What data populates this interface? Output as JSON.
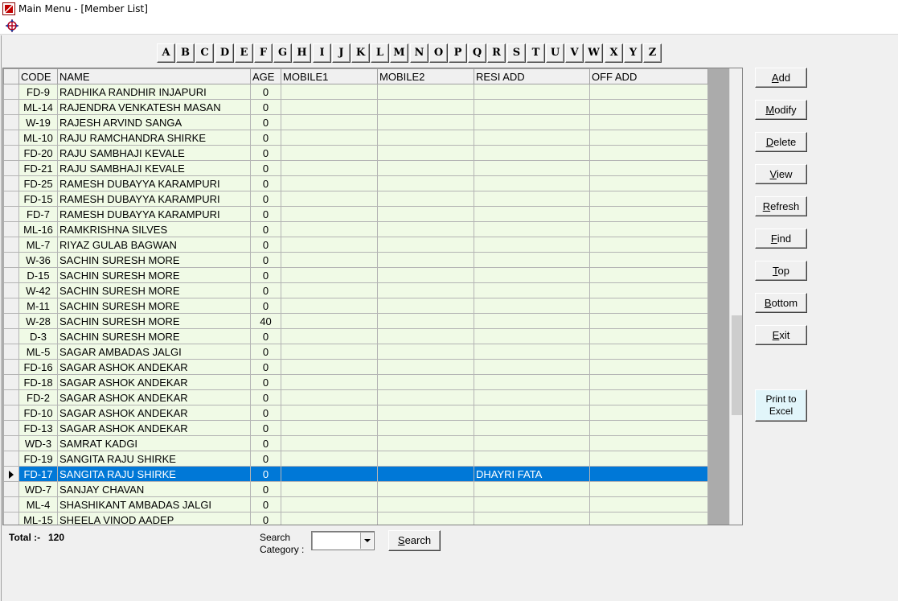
{
  "window": {
    "title": "Main Menu - [Member List]"
  },
  "alphabet": [
    "A",
    "B",
    "C",
    "D",
    "E",
    "F",
    "G",
    "H",
    "I",
    "J",
    "K",
    "L",
    "M",
    "N",
    "O",
    "P",
    "Q",
    "R",
    "S",
    "T",
    "U",
    "V",
    "W",
    "X",
    "Y",
    "Z"
  ],
  "grid": {
    "columns": [
      "CODE",
      "NAME",
      "AGE",
      "MOBILE1",
      "MOBILE2",
      "RESI ADD",
      "OFF ADD"
    ],
    "selected_index": 25,
    "rows": [
      {
        "code": "FD-9",
        "name": "RADHIKA RANDHIR INJAPURI",
        "age": "0",
        "mobile1": "",
        "mobile2": "",
        "resi": "",
        "off": ""
      },
      {
        "code": "ML-14",
        "name": "RAJENDRA VENKATESH MASAN",
        "age": "0",
        "mobile1": "",
        "mobile2": "",
        "resi": "",
        "off": ""
      },
      {
        "code": "W-19",
        "name": "RAJESH ARVIND SANGA",
        "age": "0",
        "mobile1": "",
        "mobile2": "",
        "resi": "",
        "off": ""
      },
      {
        "code": "ML-10",
        "name": "RAJU RAMCHANDRA SHIRKE",
        "age": "0",
        "mobile1": "",
        "mobile2": "",
        "resi": "",
        "off": ""
      },
      {
        "code": "FD-20",
        "name": "RAJU SAMBHAJI KEVALE",
        "age": "0",
        "mobile1": "",
        "mobile2": "",
        "resi": "",
        "off": ""
      },
      {
        "code": "FD-21",
        "name": "RAJU SAMBHAJI KEVALE",
        "age": "0",
        "mobile1": "",
        "mobile2": "",
        "resi": "",
        "off": ""
      },
      {
        "code": "FD-25",
        "name": "RAMESH DUBAYYA KARAMPURI",
        "age": "0",
        "mobile1": "",
        "mobile2": "",
        "resi": "",
        "off": ""
      },
      {
        "code": "FD-15",
        "name": "RAMESH DUBAYYA KARAMPURI",
        "age": "0",
        "mobile1": "",
        "mobile2": "",
        "resi": "",
        "off": ""
      },
      {
        "code": "FD-7",
        "name": "RAMESH DUBAYYA KARAMPURI",
        "age": "0",
        "mobile1": "",
        "mobile2": "",
        "resi": "",
        "off": ""
      },
      {
        "code": "ML-16",
        "name": "RAMKRISHNA SILVES",
        "age": "0",
        "mobile1": "",
        "mobile2": "",
        "resi": "",
        "off": ""
      },
      {
        "code": "ML-7",
        "name": "RIYAZ GULAB BAGWAN",
        "age": "0",
        "mobile1": "",
        "mobile2": "",
        "resi": "",
        "off": ""
      },
      {
        "code": "W-36",
        "name": "SACHIN SURESH MORE",
        "age": "0",
        "mobile1": "",
        "mobile2": "",
        "resi": "",
        "off": ""
      },
      {
        "code": "D-15",
        "name": "SACHIN SURESH MORE",
        "age": "0",
        "mobile1": "",
        "mobile2": "",
        "resi": "",
        "off": ""
      },
      {
        "code": "W-42",
        "name": "SACHIN SURESH MORE",
        "age": "0",
        "mobile1": "",
        "mobile2": "",
        "resi": "",
        "off": ""
      },
      {
        "code": "M-11",
        "name": "SACHIN SURESH MORE",
        "age": "0",
        "mobile1": "",
        "mobile2": "",
        "resi": "",
        "off": ""
      },
      {
        "code": "W-28",
        "name": "SACHIN SURESH MORE",
        "age": "40",
        "mobile1": "",
        "mobile2": "",
        "resi": "",
        "off": ""
      },
      {
        "code": "D-3",
        "name": "SACHIN SURESH MORE",
        "age": "0",
        "mobile1": "",
        "mobile2": "",
        "resi": "",
        "off": ""
      },
      {
        "code": "ML-5",
        "name": "SAGAR AMBADAS JALGI",
        "age": "0",
        "mobile1": "",
        "mobile2": "",
        "resi": "",
        "off": ""
      },
      {
        "code": "FD-16",
        "name": "SAGAR ASHOK ANDEKAR",
        "age": "0",
        "mobile1": "",
        "mobile2": "",
        "resi": "",
        "off": ""
      },
      {
        "code": "FD-18",
        "name": "SAGAR ASHOK ANDEKAR",
        "age": "0",
        "mobile1": "",
        "mobile2": "",
        "resi": "",
        "off": ""
      },
      {
        "code": "FD-2",
        "name": "SAGAR ASHOK ANDEKAR",
        "age": "0",
        "mobile1": "",
        "mobile2": "",
        "resi": "",
        "off": ""
      },
      {
        "code": "FD-10",
        "name": "SAGAR ASHOK ANDEKAR",
        "age": "0",
        "mobile1": "",
        "mobile2": "",
        "resi": "",
        "off": ""
      },
      {
        "code": "FD-13",
        "name": "SAGAR ASHOK ANDEKAR",
        "age": "0",
        "mobile1": "",
        "mobile2": "",
        "resi": "",
        "off": ""
      },
      {
        "code": "WD-3",
        "name": "SAMRAT KADGI",
        "age": "0",
        "mobile1": "",
        "mobile2": "",
        "resi": "",
        "off": ""
      },
      {
        "code": "FD-19",
        "name": "SANGITA RAJU SHIRKE",
        "age": "0",
        "mobile1": "",
        "mobile2": "",
        "resi": "",
        "off": ""
      },
      {
        "code": "FD-17",
        "name": "SANGITA RAJU SHIRKE",
        "age": "0",
        "mobile1": "",
        "mobile2": "",
        "resi": "DHAYRI FATA",
        "off": ""
      },
      {
        "code": "WD-7",
        "name": "SANJAY CHAVAN",
        "age": "0",
        "mobile1": "",
        "mobile2": "",
        "resi": "",
        "off": ""
      },
      {
        "code": "ML-4",
        "name": "SHASHIKANT AMBADAS JALGI",
        "age": "0",
        "mobile1": "",
        "mobile2": "",
        "resi": "",
        "off": ""
      },
      {
        "code": "ML-15",
        "name": "SHEELA VINOD AADEP",
        "age": "0",
        "mobile1": "",
        "mobile2": "",
        "resi": "",
        "off": ""
      }
    ]
  },
  "actions": {
    "add": {
      "pre": "",
      "key": "A",
      "post": "dd"
    },
    "modify": {
      "pre": "",
      "key": "M",
      "post": "odify"
    },
    "delete": {
      "pre": "",
      "key": "D",
      "post": "elete"
    },
    "view": {
      "pre": "",
      "key": "V",
      "post": "iew"
    },
    "refresh": {
      "pre": "",
      "key": "R",
      "post": "efresh"
    },
    "find": {
      "pre": "",
      "key": "F",
      "post": "ind"
    },
    "top": {
      "pre": "",
      "key": "T",
      "post": "op"
    },
    "bottom": {
      "pre": "",
      "key": "B",
      "post": "ottom"
    },
    "exit": {
      "pre": "",
      "key": "E",
      "post": "xit"
    },
    "print_line1": "Print to",
    "print_line2": "Excel"
  },
  "footer": {
    "total_label": "Total :-",
    "total_value": "120",
    "search_label_line1": "Search",
    "search_label_line2": "Category :",
    "search_category_value": "",
    "search_button": {
      "pre": "",
      "key": "S",
      "post": "earch"
    }
  },
  "colors": {
    "row_bg": "#f0fae6",
    "selection": "#0078d7",
    "grid_backdrop": "#ababab",
    "print_button_bg": "#e1f5fa"
  }
}
